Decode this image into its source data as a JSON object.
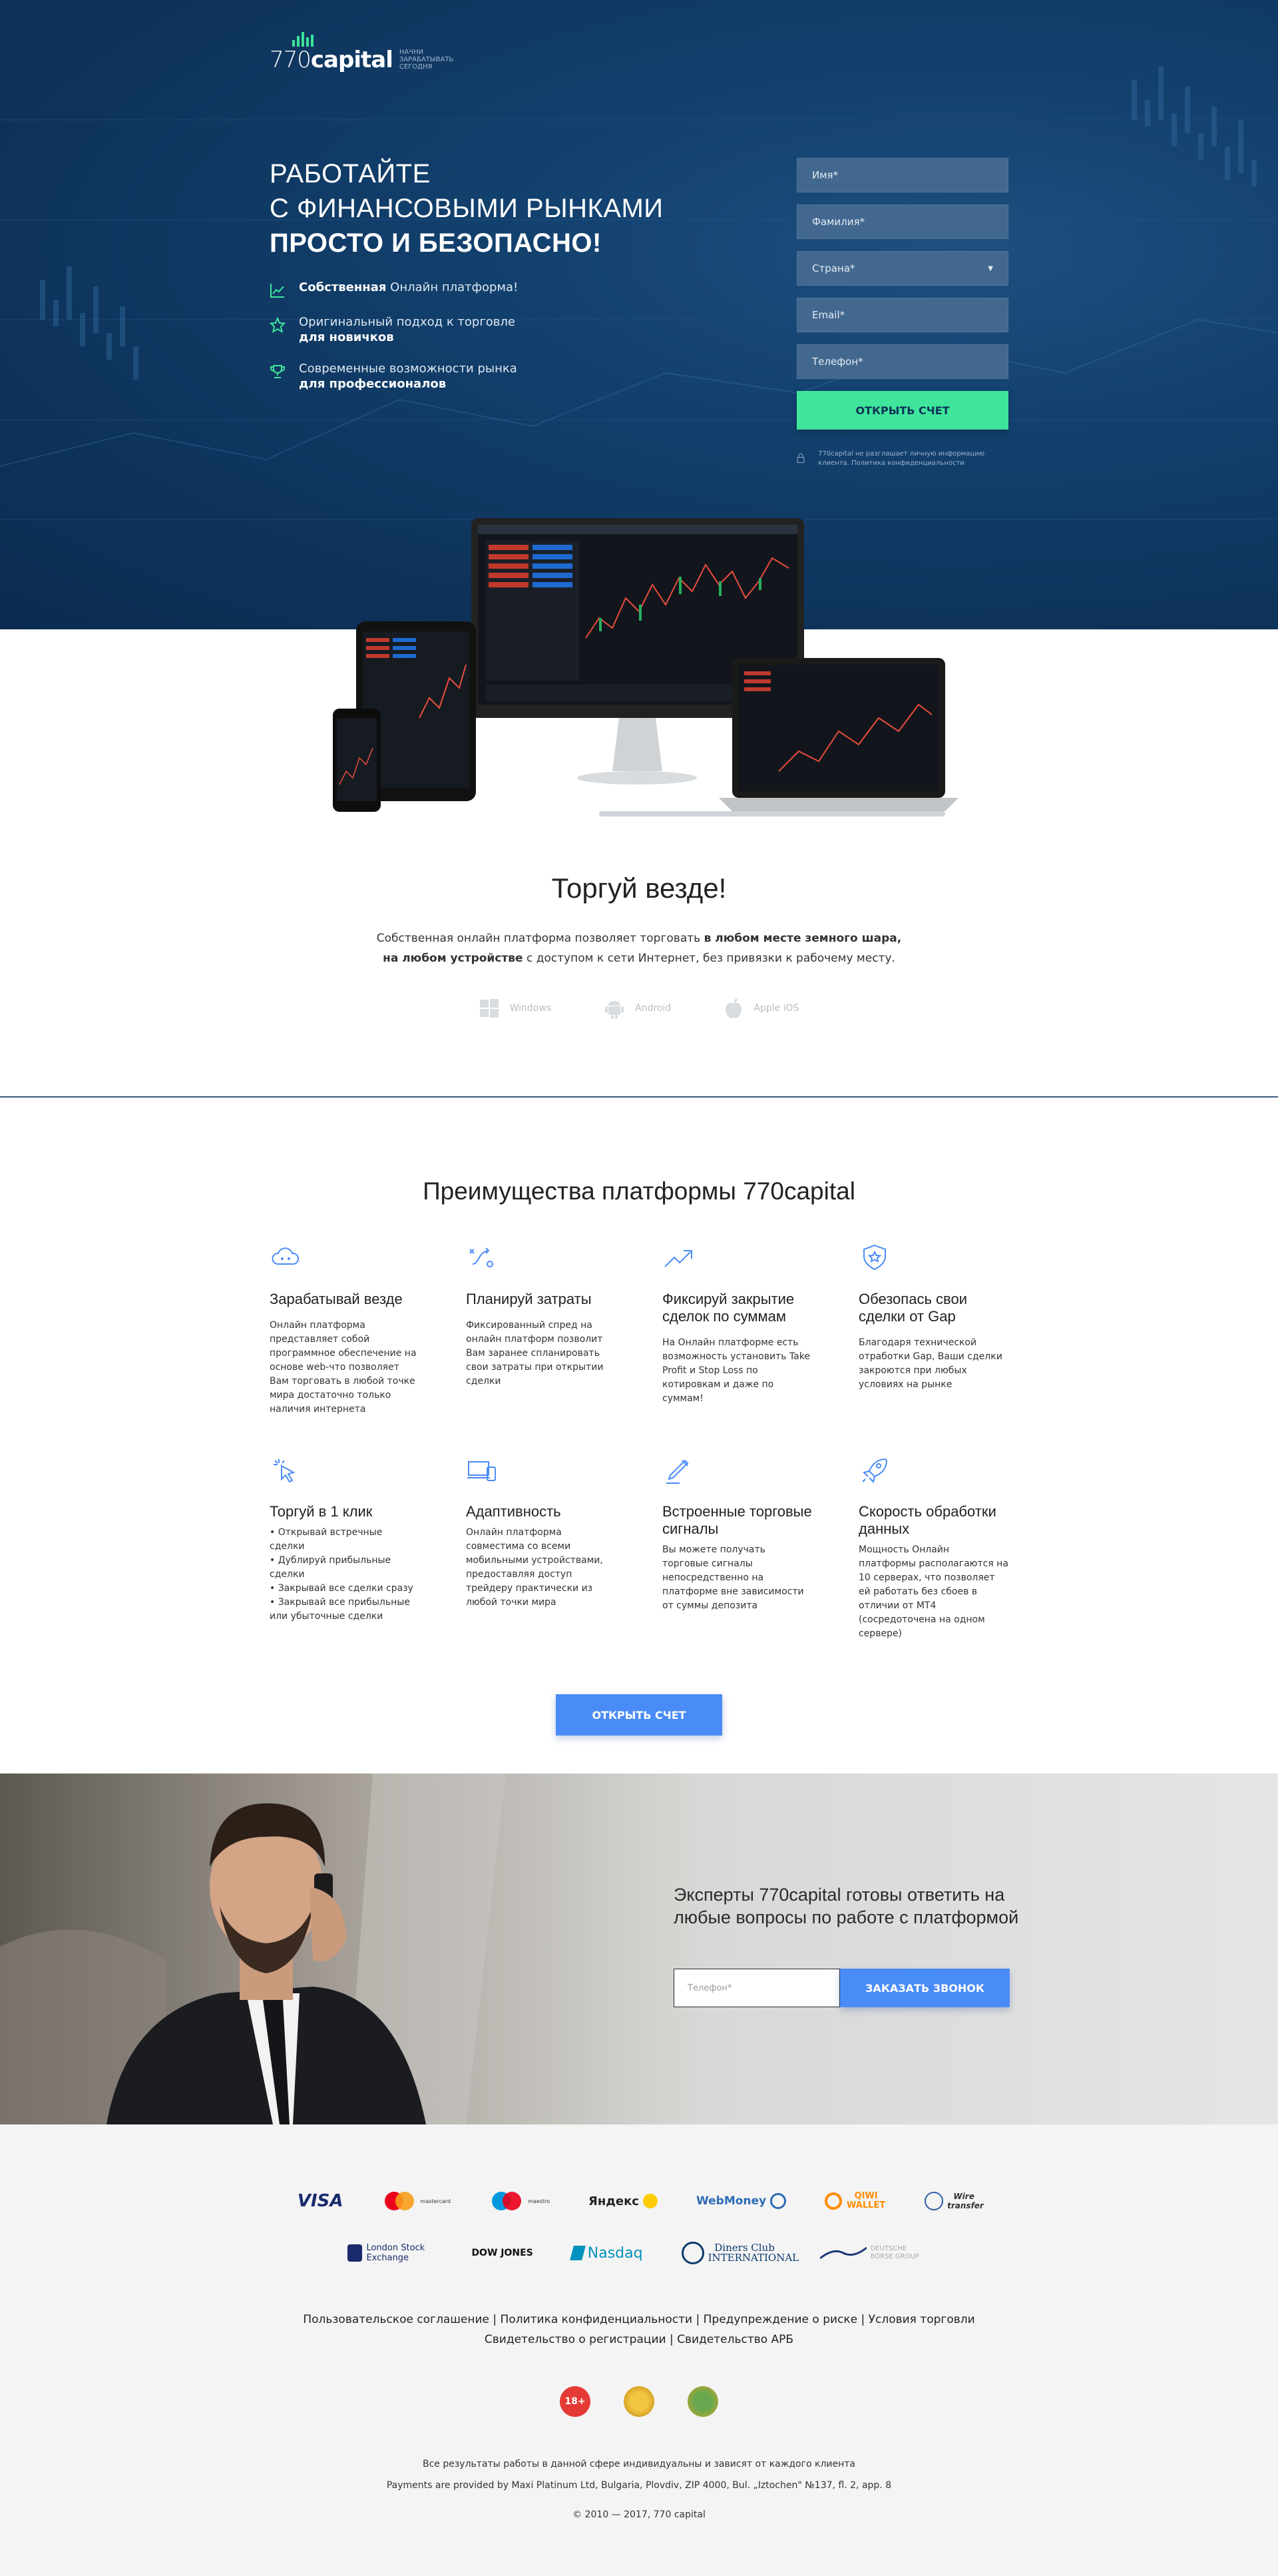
{
  "brand": {
    "name_light": "770",
    "name_bold": "capital",
    "tagline": "НАЧНИ ЗАРАБАТЫВАТЬ СЕГОДНЯ"
  },
  "hero": {
    "line1": "РАБОТАЙТЕ",
    "line2": "С ФИНАНСОВЫМИ РЫНКАМИ",
    "line3": "ПРОСТО И БЕЗОПАСНО!",
    "features": [
      {
        "icon": "chart-line-icon",
        "bold": "Собственная",
        "text": " Онлайн платформа!"
      },
      {
        "icon": "star-icon",
        "text": "Оригинальный подход к торговле ",
        "bold": "для новичков"
      },
      {
        "icon": "trophy-icon",
        "text": "Современные возможности рынка ",
        "bold": "для профессионалов"
      }
    ]
  },
  "form": {
    "name": "Имя*",
    "surname": "Фамилия*",
    "country": "Страна*",
    "email": "Email*",
    "phone": "Телефон*",
    "submit": "ОТКРЫТЬ СЧЕТ",
    "privacy": "770capital не разглашает личную информацию клиента. Политика конфиденциальности"
  },
  "trade": {
    "title": "Торгуй везде!",
    "p1_start": "Собственная онлайн платформа позволяет торговать ",
    "p1_bold": "в любом месте земного шара,",
    "p2_bold": "на любом устройстве",
    "p2_end": " с доступом к сети Интернет, без привязки к рабочему месту.",
    "platforms": [
      "Windows",
      "Android",
      "Apple iOS"
    ]
  },
  "advantages": {
    "title": "Преимущества платформы 770capital",
    "items": [
      {
        "icon": "cloud-robot-icon",
        "title": "Зарабатывай везде",
        "text": "Онлайн платформа представляет собой программное обеспечение на основе web-что позволяет Вам торговать в любой точке мира достаточно только наличия интернета"
      },
      {
        "icon": "strategy-icon",
        "title": "Планируй затраты",
        "text": "Фиксированный спред на онлайн платформ позволит Вам заранее спланировать свои затраты при открытии сделки"
      },
      {
        "icon": "trend-arrow-icon",
        "title": "Фиксируй закрытие сделок по суммам",
        "text": "На Онлайн платформе есть возможность установить Take Profit и Stop Loss по котировкам и даже по суммам!"
      },
      {
        "icon": "shield-star-icon",
        "title": "Обезопась свои сделки от Gap",
        "text": "Благодаря технической отработки Gap, Ваши сделки закроются при любых условиях на рынке"
      },
      {
        "icon": "cursor-click-icon",
        "title": "Торгуй в 1 клик",
        "text": "• Открывай встречные сделки\n• Дублируй прибыльные сделки\n• Закрывай все сделки сразу\n• Закрывай все прибыльные или убыточные сделки"
      },
      {
        "icon": "devices-icon",
        "title": "Адаптивность",
        "text": "Онлайн платформа совместима со всеми мобильными устройствами, предоставляя доступ трейдеру практически из любой точки мира"
      },
      {
        "icon": "signal-pen-icon",
        "title": "Встроенные торговые сигналы",
        "text": "Вы можете получать торговые сигналы непосредственно на платформе вне зависимости от суммы депозита"
      },
      {
        "icon": "rocket-icon",
        "title": "Скорость обработки данных",
        "text": "Мощность Онлайн платформы располагаются на 10 серверах, что позволяет ей работать без сбоев в отличии от MT4 (сосредоточена на одном сервере)"
      }
    ],
    "button": "ОТКРЫТЬ СЧЕТ"
  },
  "experts": {
    "title": "Эксперты 770capital готовы ответить на любые вопросы по работе с платформой",
    "phone_placeholder": "Телефон*",
    "button": "ЗАКАЗАТЬ ЗВОНОК"
  },
  "footer": {
    "payments_row1": [
      "VISA",
      "mastercard",
      "maestro",
      "Яндекс",
      "WebMoney",
      "QIWI WALLET",
      "Wire transfer"
    ],
    "payments_row2": [
      "London Stock Exchange",
      "DOW JONES",
      "Nasdaq",
      "Diners Club INTERNATIONAL",
      "DEUTSCHE BÖRSE GROUP"
    ],
    "links1": "Пользовательское соглашение | Политика конфиденциальности | Предупреждение о риске | Условия торговли",
    "links2": "Свидетельство о регистрации | Свидетельство АРБ",
    "badges": [
      "18+",
      "",
      ""
    ],
    "note1": "Все результаты работы в данной сфере индивидуальны и зависят от каждого клиента",
    "note2": "Payments are provided by Maxi Platinum Ltd, Bulgaria, Plovdiv, ZIP 4000, Bul. „Iztochen\" №137, fl. 2, app. 8",
    "copyright": "© 2010 — 2017, 770 capital"
  },
  "colors": {
    "hero_bg": "#0e3660",
    "accent_green": "#3fe59a",
    "accent_blue": "#4a8cf7",
    "field_bg": "#43688f"
  }
}
